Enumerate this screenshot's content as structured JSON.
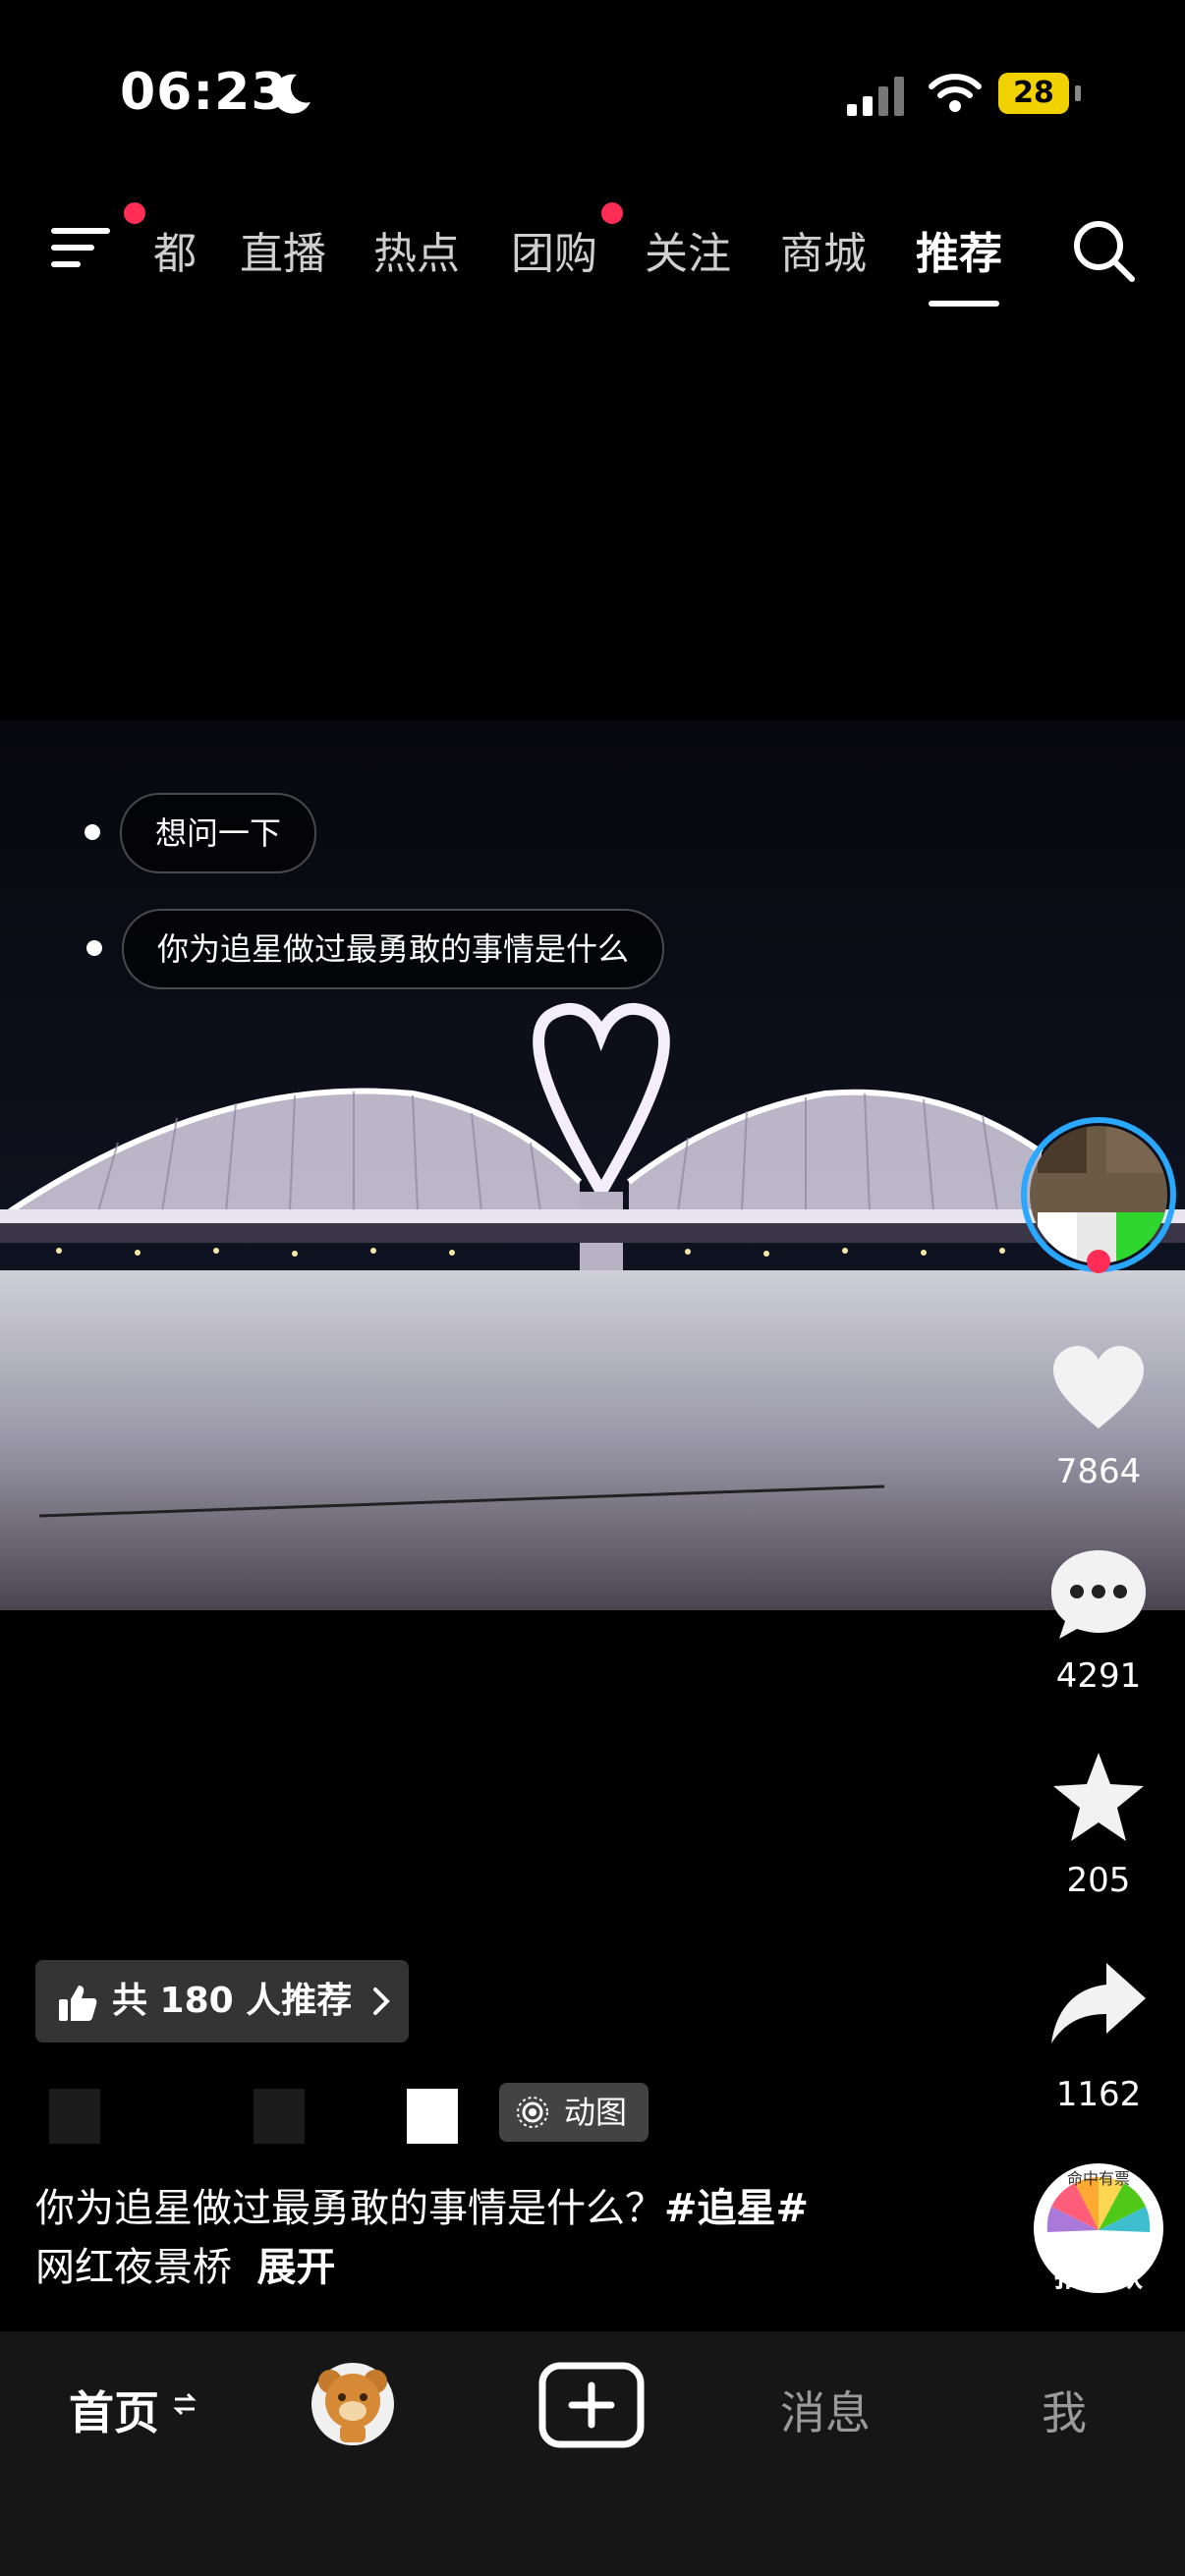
{
  "status_bar": {
    "time": "06:23",
    "battery": "28"
  },
  "top_nav": {
    "tabs": [
      "都",
      "直播",
      "热点",
      "团购",
      "关注",
      "商城",
      "推荐"
    ],
    "active_tab": "推荐"
  },
  "video": {
    "bubbles": [
      "想问一下",
      "你为追星做过最勇敢的事情是什么"
    ]
  },
  "actions": {
    "likes": "7864",
    "comments": "4291",
    "favorites": "205",
    "shares": "1162",
    "same_style_label": "拍同款",
    "music_disc_text": "命中有票"
  },
  "info": {
    "recommend_text": "共 180 人推荐",
    "tag_label": "动图",
    "caption_line1": "你为追星做过最勇敢的事情是什么？",
    "caption_hashtag": "#追星#",
    "caption_line2": "网红夜景桥",
    "expand_label": "展开"
  },
  "bottom_nav": {
    "home": "首页",
    "messages": "消息",
    "me": "我"
  },
  "colors": {
    "accent_red": "#ff2d55",
    "battery_yellow": "#f2d100",
    "background": "#000000"
  }
}
